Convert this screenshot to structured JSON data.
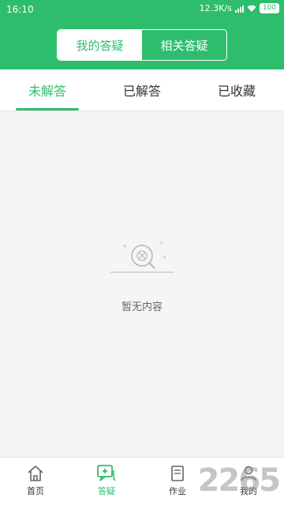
{
  "status": {
    "time": "16:10",
    "speed": "12.3K/s",
    "battery": "100"
  },
  "segment": {
    "active": "我的答疑",
    "inactive": "相关答疑"
  },
  "tabs": [
    "未解答",
    "已解答",
    "已收藏"
  ],
  "empty": {
    "text": "暂无内容"
  },
  "nav": [
    {
      "label": "首页",
      "icon": "home-icon"
    },
    {
      "label": "答疑",
      "icon": "qa-icon"
    },
    {
      "label": "作业",
      "icon": "homework-icon"
    },
    {
      "label": "我的",
      "icon": "profile-icon"
    }
  ],
  "watermark": "2265",
  "colors": {
    "primary": "#2ebd6d"
  }
}
